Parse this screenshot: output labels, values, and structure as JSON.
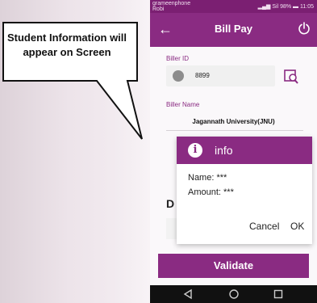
{
  "callout": {
    "text": "Student Information will appear on Screen"
  },
  "status_bar": {
    "carrier_line1": "grameenphone",
    "carrier_line2": "Robi",
    "signal_text": "Sil",
    "battery": "98%",
    "time": "11:05"
  },
  "app_bar": {
    "title": "Bill Pay",
    "back_icon": "arrow-left-icon",
    "power_icon": "power-icon"
  },
  "form": {
    "biller_id_label": "Biller ID",
    "biller_id_value": "8899",
    "biller_name_label": "Biller Name",
    "biller_name_value": "Jagannath University(JNU)",
    "partial_letter": "D"
  },
  "dialog": {
    "title": "info",
    "icon": "info-icon",
    "name_line": "Name: ***",
    "amount_line": "Amount: ***",
    "cancel_label": "Cancel",
    "ok_label": "OK"
  },
  "validate_label": "Validate",
  "colors": {
    "primary": "#8a2b82",
    "status": "#7b1f72"
  }
}
